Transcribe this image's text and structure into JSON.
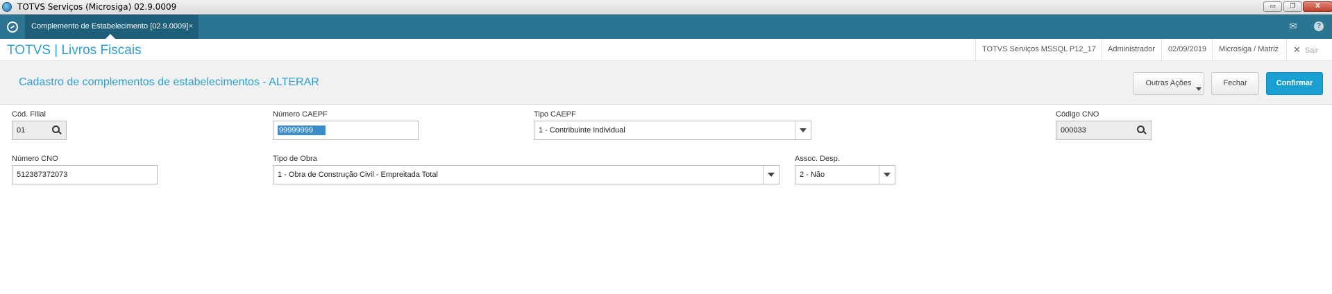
{
  "window": {
    "title": "TOTVS Serviços (Microsiga) 02.9.0009",
    "minimize": "▭",
    "restore": "❐",
    "close": "X"
  },
  "tabbar": {
    "tab_label": "Complemento de Estabelecimento [02.9.0009]",
    "tab_close": "×",
    "mail_icon": "✉",
    "help_icon": "?"
  },
  "header": {
    "brand": "TOTVS | Livros Fiscais",
    "environment": "TOTVS Serviços MSSQL P12_17",
    "user": "Administrador",
    "date": "02/09/2019",
    "company": "Microsiga / Matriz",
    "exit_label": "Sair",
    "exit_icon": "✕"
  },
  "page": {
    "title": "Cadastro de complementos de estabelecimentos - ALTERAR",
    "actions_label": "Outras Ações",
    "close_label": "Fechar",
    "confirm_label": "Confirmar"
  },
  "form": {
    "cod_filial": {
      "label": "Cód. Filial",
      "value": "01"
    },
    "numero_caepf": {
      "label": "Número CAEPF",
      "value": "99999999"
    },
    "tipo_caepf": {
      "label": "Tipo CAEPF",
      "value": "1 - Contribuinte Individual"
    },
    "codigo_cno": {
      "label": "Código CNO",
      "value": "000033"
    },
    "numero_cno": {
      "label": "Número CNO",
      "value": "512387372073"
    },
    "tipo_obra": {
      "label": "Tipo de Obra",
      "value": "1 - Obra de Construção Civil - Empreitada Total"
    },
    "assoc_desp": {
      "label": "Assoc. Desp.",
      "value": "2 - Não"
    }
  }
}
